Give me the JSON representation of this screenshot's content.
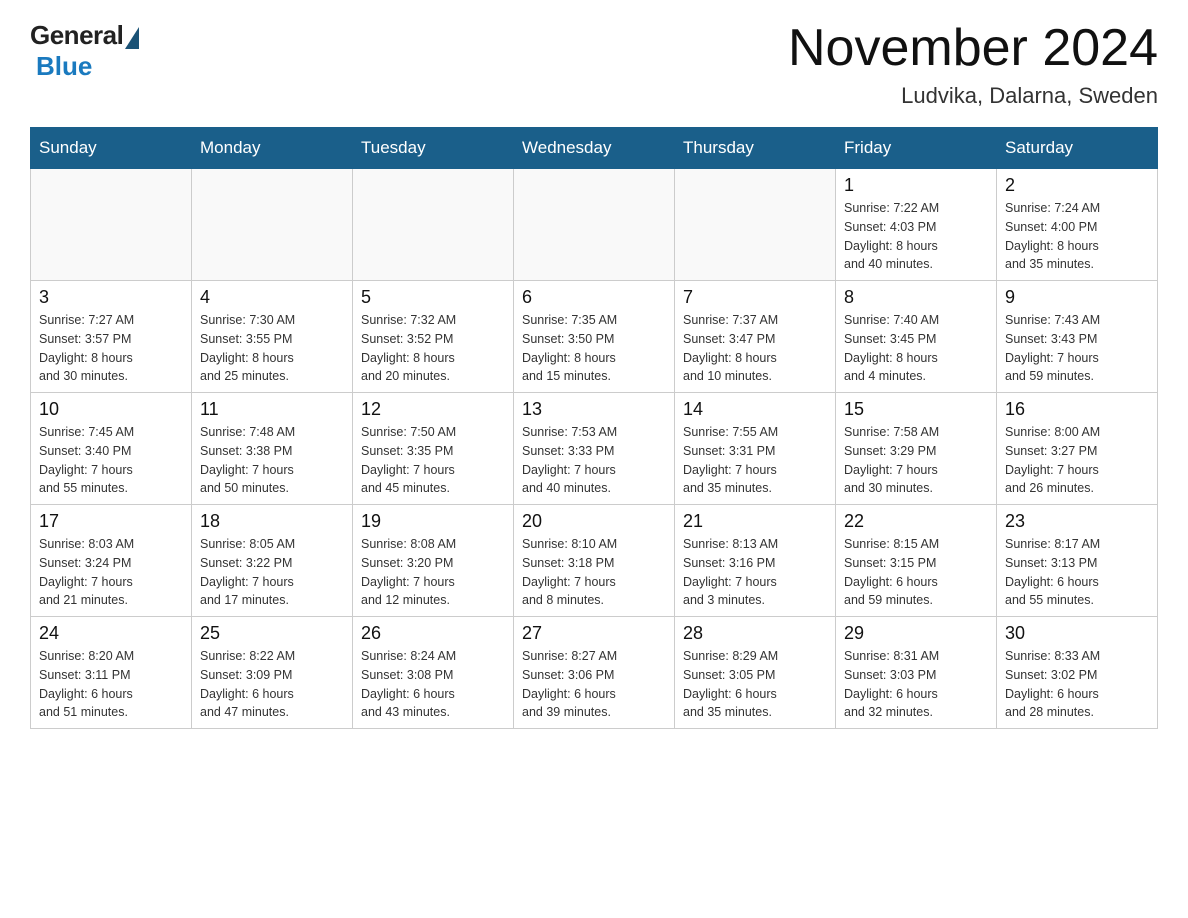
{
  "header": {
    "logo_general": "General",
    "logo_blue": "Blue",
    "title": "November 2024",
    "subtitle": "Ludvika, Dalarna, Sweden"
  },
  "weekdays": [
    "Sunday",
    "Monday",
    "Tuesday",
    "Wednesday",
    "Thursday",
    "Friday",
    "Saturday"
  ],
  "weeks": [
    [
      {
        "day": "",
        "info": ""
      },
      {
        "day": "",
        "info": ""
      },
      {
        "day": "",
        "info": ""
      },
      {
        "day": "",
        "info": ""
      },
      {
        "day": "",
        "info": ""
      },
      {
        "day": "1",
        "info": "Sunrise: 7:22 AM\nSunset: 4:03 PM\nDaylight: 8 hours\nand 40 minutes."
      },
      {
        "day": "2",
        "info": "Sunrise: 7:24 AM\nSunset: 4:00 PM\nDaylight: 8 hours\nand 35 minutes."
      }
    ],
    [
      {
        "day": "3",
        "info": "Sunrise: 7:27 AM\nSunset: 3:57 PM\nDaylight: 8 hours\nand 30 minutes."
      },
      {
        "day": "4",
        "info": "Sunrise: 7:30 AM\nSunset: 3:55 PM\nDaylight: 8 hours\nand 25 minutes."
      },
      {
        "day": "5",
        "info": "Sunrise: 7:32 AM\nSunset: 3:52 PM\nDaylight: 8 hours\nand 20 minutes."
      },
      {
        "day": "6",
        "info": "Sunrise: 7:35 AM\nSunset: 3:50 PM\nDaylight: 8 hours\nand 15 minutes."
      },
      {
        "day": "7",
        "info": "Sunrise: 7:37 AM\nSunset: 3:47 PM\nDaylight: 8 hours\nand 10 minutes."
      },
      {
        "day": "8",
        "info": "Sunrise: 7:40 AM\nSunset: 3:45 PM\nDaylight: 8 hours\nand 4 minutes."
      },
      {
        "day": "9",
        "info": "Sunrise: 7:43 AM\nSunset: 3:43 PM\nDaylight: 7 hours\nand 59 minutes."
      }
    ],
    [
      {
        "day": "10",
        "info": "Sunrise: 7:45 AM\nSunset: 3:40 PM\nDaylight: 7 hours\nand 55 minutes."
      },
      {
        "day": "11",
        "info": "Sunrise: 7:48 AM\nSunset: 3:38 PM\nDaylight: 7 hours\nand 50 minutes."
      },
      {
        "day": "12",
        "info": "Sunrise: 7:50 AM\nSunset: 3:35 PM\nDaylight: 7 hours\nand 45 minutes."
      },
      {
        "day": "13",
        "info": "Sunrise: 7:53 AM\nSunset: 3:33 PM\nDaylight: 7 hours\nand 40 minutes."
      },
      {
        "day": "14",
        "info": "Sunrise: 7:55 AM\nSunset: 3:31 PM\nDaylight: 7 hours\nand 35 minutes."
      },
      {
        "day": "15",
        "info": "Sunrise: 7:58 AM\nSunset: 3:29 PM\nDaylight: 7 hours\nand 30 minutes."
      },
      {
        "day": "16",
        "info": "Sunrise: 8:00 AM\nSunset: 3:27 PM\nDaylight: 7 hours\nand 26 minutes."
      }
    ],
    [
      {
        "day": "17",
        "info": "Sunrise: 8:03 AM\nSunset: 3:24 PM\nDaylight: 7 hours\nand 21 minutes."
      },
      {
        "day": "18",
        "info": "Sunrise: 8:05 AM\nSunset: 3:22 PM\nDaylight: 7 hours\nand 17 minutes."
      },
      {
        "day": "19",
        "info": "Sunrise: 8:08 AM\nSunset: 3:20 PM\nDaylight: 7 hours\nand 12 minutes."
      },
      {
        "day": "20",
        "info": "Sunrise: 8:10 AM\nSunset: 3:18 PM\nDaylight: 7 hours\nand 8 minutes."
      },
      {
        "day": "21",
        "info": "Sunrise: 8:13 AM\nSunset: 3:16 PM\nDaylight: 7 hours\nand 3 minutes."
      },
      {
        "day": "22",
        "info": "Sunrise: 8:15 AM\nSunset: 3:15 PM\nDaylight: 6 hours\nand 59 minutes."
      },
      {
        "day": "23",
        "info": "Sunrise: 8:17 AM\nSunset: 3:13 PM\nDaylight: 6 hours\nand 55 minutes."
      }
    ],
    [
      {
        "day": "24",
        "info": "Sunrise: 8:20 AM\nSunset: 3:11 PM\nDaylight: 6 hours\nand 51 minutes."
      },
      {
        "day": "25",
        "info": "Sunrise: 8:22 AM\nSunset: 3:09 PM\nDaylight: 6 hours\nand 47 minutes."
      },
      {
        "day": "26",
        "info": "Sunrise: 8:24 AM\nSunset: 3:08 PM\nDaylight: 6 hours\nand 43 minutes."
      },
      {
        "day": "27",
        "info": "Sunrise: 8:27 AM\nSunset: 3:06 PM\nDaylight: 6 hours\nand 39 minutes."
      },
      {
        "day": "28",
        "info": "Sunrise: 8:29 AM\nSunset: 3:05 PM\nDaylight: 6 hours\nand 35 minutes."
      },
      {
        "day": "29",
        "info": "Sunrise: 8:31 AM\nSunset: 3:03 PM\nDaylight: 6 hours\nand 32 minutes."
      },
      {
        "day": "30",
        "info": "Sunrise: 8:33 AM\nSunset: 3:02 PM\nDaylight: 6 hours\nand 28 minutes."
      }
    ]
  ]
}
